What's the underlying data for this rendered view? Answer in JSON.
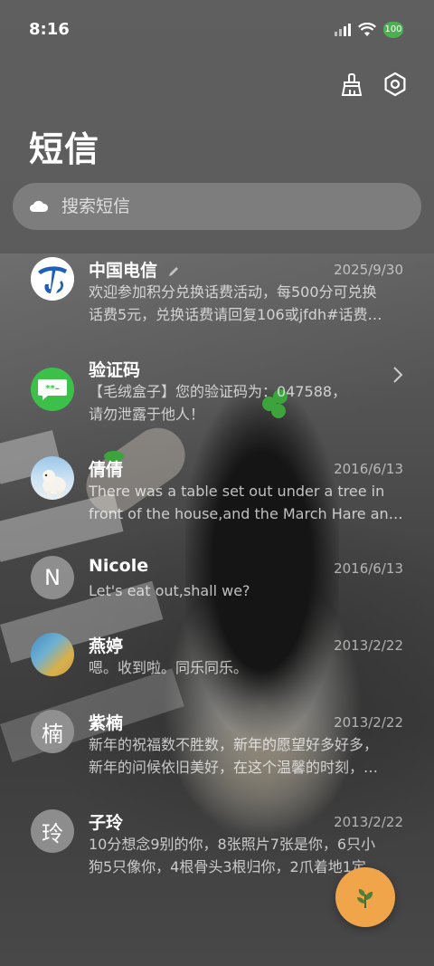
{
  "status_bar": {
    "time": "8:16",
    "battery": "100"
  },
  "header": {
    "title": "短信"
  },
  "search": {
    "placeholder": "搜索短信"
  },
  "conversations": [
    {
      "name": "中国电信",
      "date": "2025/9/30",
      "preview": [
        "欢迎参加积分兑换话费活动，每500分可兑换",
        "话费5元，兑换话费请回复106或jfdh#话费…"
      ],
      "avatar": "china-telecom-logo"
    },
    {
      "name": "验证码",
      "date": "",
      "preview": [
        "【毛绒盒子】您的验证码为：047588，",
        "请勿泄露于他人！"
      ],
      "avatar": "verification-code-icon"
    },
    {
      "name": "倩倩",
      "date": "2016/6/13",
      "preview": [
        "There was a table set out under a tree in",
        "front of the house,and the March Hare an…"
      ],
      "avatar": "polar-bear-photo"
    },
    {
      "name": "Nicole",
      "date": "2016/6/13",
      "preview": [
        "Let's eat out,shall we?"
      ],
      "avatar_letter": "N"
    },
    {
      "name": "燕婷",
      "date": "2013/2/22",
      "preview": [
        "嗯。收到啦。同乐同乐。"
      ],
      "avatar": "landscape-photo"
    },
    {
      "name": "紫楠",
      "date": "2013/2/22",
      "preview": [
        "新年的祝福数不胜数，新年的愿望好多好多，",
        "新年的问候依旧美好，在这个温馨的时刻，…"
      ],
      "avatar_letter": "楠"
    },
    {
      "name": "子玲",
      "date": "2013/2/22",
      "preview": [
        "10分想念9别的你，8张照片7张是你，6只小",
        "狗5只像你，4根骨头3根归你，2爪着地1定…"
      ],
      "avatar_letter": "玲"
    }
  ],
  "colors": {
    "fab": "#f0a54a",
    "verify_green": "#3cc04a",
    "telecom_blue": "#1f5fb8"
  }
}
